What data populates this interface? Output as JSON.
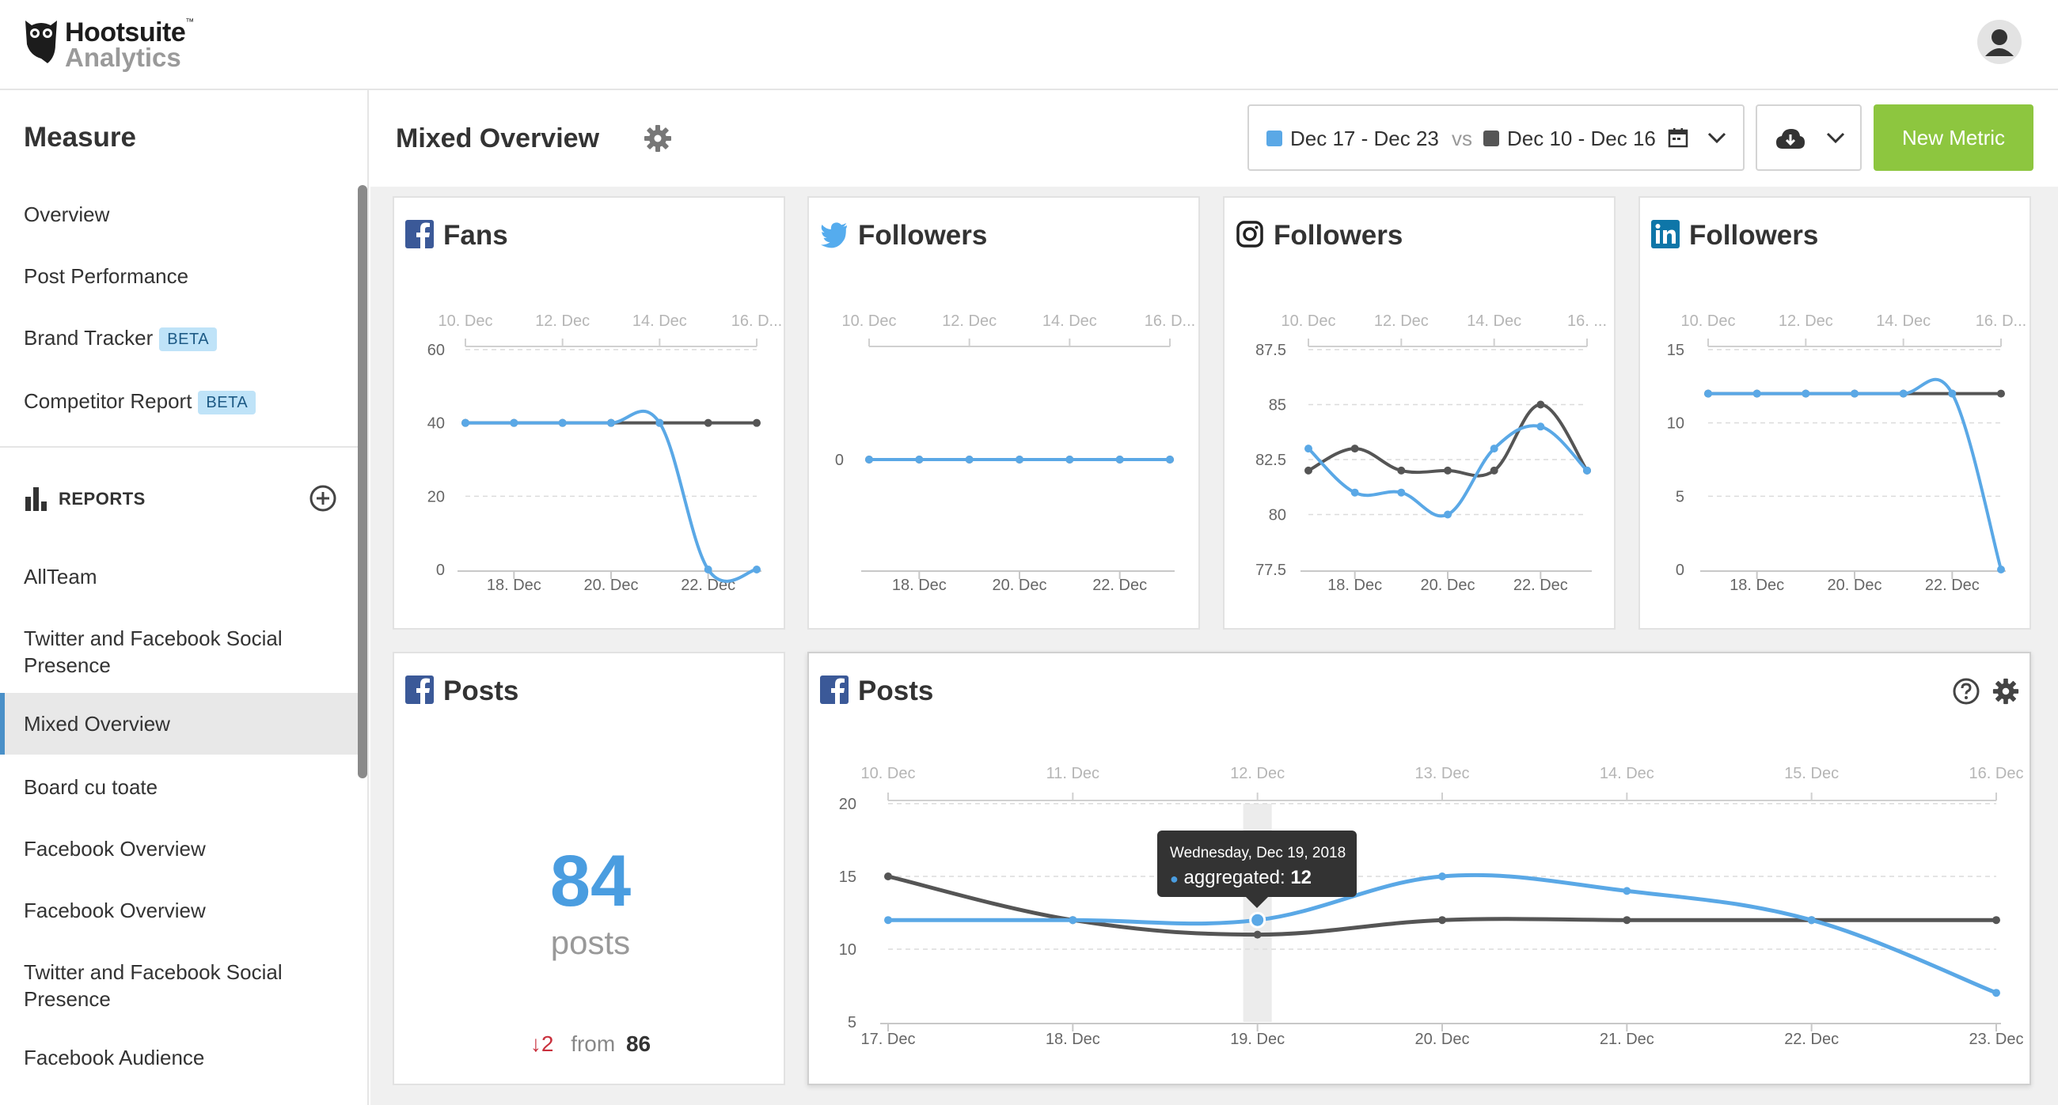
{
  "app": {
    "brand": "Hootsuite",
    "tm": "™",
    "product": "Analytics"
  },
  "sidebar": {
    "title": "Measure",
    "items": [
      {
        "label": "Overview"
      },
      {
        "label": "Post Performance"
      },
      {
        "label": "Brand Tracker",
        "badge": "BETA"
      },
      {
        "label": "Competitor Report",
        "badge": "BETA"
      }
    ],
    "reports_label": "REPORTS",
    "reports": [
      {
        "label": "AllTeam"
      },
      {
        "label": "Twitter and Facebook Social Presence"
      },
      {
        "label": "Mixed Overview",
        "active": true
      },
      {
        "label": "Board cu toate"
      },
      {
        "label": "Facebook Overview"
      },
      {
        "label": "Facebook Overview"
      },
      {
        "label": "Twitter and Facebook Social Presence"
      },
      {
        "label": "Facebook Audience"
      }
    ]
  },
  "header": {
    "title": "Mixed Overview",
    "range_current": "Dec 17 - Dec 23",
    "vs": "vs",
    "range_previous": "Dec 10 - Dec 16",
    "new_metric": "New Metric"
  },
  "colors": {
    "current": "#5aa8e6",
    "previous": "#555555",
    "accent_green": "#8dc63f",
    "facebook": "#3b5998",
    "twitter": "#55acee",
    "linkedin": "#0e76a8"
  },
  "cards": {
    "fb_fans": {
      "title": "Fans",
      "icon": "facebook-icon"
    },
    "tw_followers": {
      "title": "Followers",
      "icon": "twitter-icon"
    },
    "ig_followers": {
      "title": "Followers",
      "icon": "instagram-icon"
    },
    "li_followers": {
      "title": "Followers",
      "icon": "linkedin-icon"
    },
    "fb_posts_total": {
      "title": "Posts",
      "icon": "facebook-icon",
      "value": "84",
      "unit": "posts",
      "delta": "2",
      "from_label": "from",
      "previous": "86"
    },
    "fb_posts_chart": {
      "title": "Posts",
      "icon": "facebook-icon"
    }
  },
  "tooltip": {
    "date": "Wednesday, Dec 19, 2018",
    "label": "aggregated:",
    "value": "12"
  },
  "chart_data": [
    {
      "type": "line",
      "title": "Fans",
      "x": [
        "17. Dec",
        "18. Dec",
        "19. Dec",
        "20. Dec",
        "21. Dec",
        "22. Dec",
        "23. Dec"
      ],
      "x_ticks": [
        "18. Dec",
        "20. Dec",
        "22. Dec"
      ],
      "x_top_ticks": [
        "10. Dec",
        "12. Dec",
        "14. Dec",
        "16. D..."
      ],
      "y_ticks": [
        0,
        20,
        40,
        60
      ],
      "ylim": [
        0,
        60
      ],
      "series": [
        {
          "values": [
            40,
            40,
            40,
            40,
            40,
            0,
            0
          ]
        },
        {
          "values": [
            40,
            40,
            40,
            40,
            40,
            40,
            40
          ]
        }
      ]
    },
    {
      "type": "line",
      "title": "Followers",
      "x": [
        "17. Dec",
        "18. Dec",
        "19. Dec",
        "20. Dec",
        "21. Dec",
        "22. Dec",
        "23. Dec"
      ],
      "x_ticks": [
        "18. Dec",
        "20. Dec",
        "22. Dec"
      ],
      "x_top_ticks": [
        "10. Dec",
        "12. Dec",
        "14. Dec",
        "16. D..."
      ],
      "y_ticks": [
        0
      ],
      "ylim": [
        -1,
        1
      ],
      "series": [
        {
          "values": [
            0,
            0,
            0,
            0,
            0,
            0,
            0
          ]
        },
        {
          "values": [
            0,
            0,
            0,
            0,
            0,
            0,
            0
          ]
        }
      ]
    },
    {
      "type": "line",
      "title": "Followers",
      "x": [
        "17. Dec",
        "18. Dec",
        "19. Dec",
        "20. Dec",
        "21. Dec",
        "22. Dec",
        "23. Dec"
      ],
      "x_ticks": [
        "18. Dec",
        "20. Dec",
        "22. Dec"
      ],
      "x_top_ticks": [
        "10. Dec",
        "12. Dec",
        "14. Dec",
        "16. ..."
      ],
      "y_ticks": [
        77.5,
        80,
        82.5,
        85,
        87.5
      ],
      "ylim": [
        77.5,
        87.5
      ],
      "series": [
        {
          "values": [
            83,
            81,
            81,
            80,
            83,
            84,
            82
          ]
        },
        {
          "values": [
            82,
            83,
            82,
            82,
            82,
            85,
            82
          ]
        }
      ]
    },
    {
      "type": "line",
      "title": "Followers",
      "x": [
        "17. Dec",
        "18. Dec",
        "19. Dec",
        "20. Dec",
        "21. Dec",
        "22. Dec",
        "23. Dec"
      ],
      "x_ticks": [
        "18. Dec",
        "20. Dec",
        "22. Dec"
      ],
      "x_top_ticks": [
        "10. Dec",
        "12. Dec",
        "14. Dec",
        "16. D..."
      ],
      "y_ticks": [
        0,
        5,
        10,
        15
      ],
      "ylim": [
        0,
        15
      ],
      "series": [
        {
          "values": [
            12,
            12,
            12,
            12,
            12,
            12,
            0
          ]
        },
        {
          "values": [
            12,
            12,
            12,
            12,
            12,
            12,
            12
          ]
        }
      ]
    },
    {
      "type": "line",
      "title": "Posts",
      "x": [
        "17. Dec",
        "18. Dec",
        "19. Dec",
        "20. Dec",
        "21. Dec",
        "22. Dec",
        "23. Dec"
      ],
      "x_ticks": [
        "17. Dec",
        "18. Dec",
        "19. Dec",
        "20. Dec",
        "21. Dec",
        "22. Dec",
        "23. Dec"
      ],
      "x_top_ticks": [
        "10. Dec",
        "11. Dec",
        "12. Dec",
        "13. Dec",
        "14. Dec",
        "15. Dec",
        "16. Dec"
      ],
      "y_ticks": [
        5,
        10,
        15,
        20
      ],
      "ylim": [
        5,
        20
      ],
      "highlight_index": 2,
      "series": [
        {
          "values": [
            12,
            12,
            12,
            15,
            14,
            12,
            7
          ]
        },
        {
          "values": [
            15,
            12,
            11,
            12,
            12,
            12,
            12
          ]
        }
      ]
    }
  ]
}
